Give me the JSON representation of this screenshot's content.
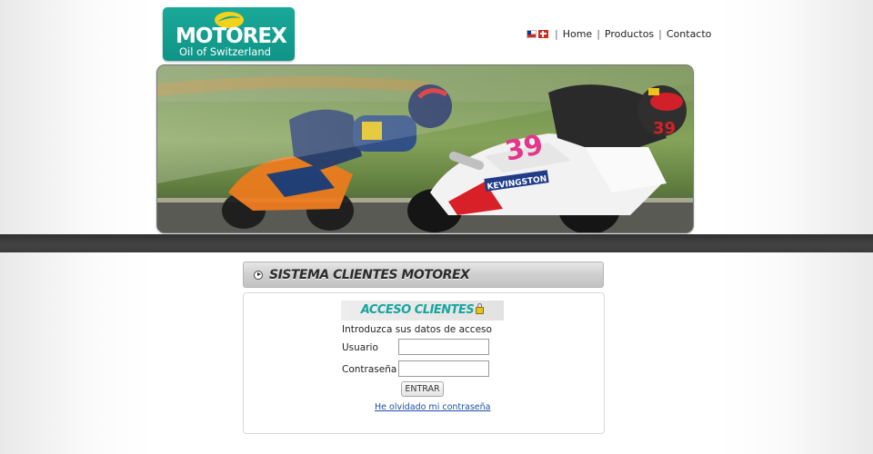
{
  "brand": {
    "name": "MOTOREX",
    "registered": "®",
    "tagline": "Oil of Switzerland",
    "color": "#14a394"
  },
  "nav": {
    "flags": [
      "chile-flag-icon",
      "switzerland-flag-icon"
    ],
    "separator": "|",
    "items": [
      "Home",
      "Productos",
      "Contacto"
    ]
  },
  "banner": {
    "bike_numbers": [
      "39"
    ],
    "sponsor_text": "KEVINGSTON"
  },
  "section": {
    "title": "SISTEMA CLIENTES MOTOREX",
    "icon": "play-circle-icon"
  },
  "login": {
    "title": "ACCESO CLIENTES",
    "title_icon": "lock-icon",
    "intro": "Introduzca sus datos de acceso",
    "user_label": "Usuario",
    "user_value": "",
    "pass_label": "Contraseña",
    "pass_value": "",
    "submit_label": "ENTRAR",
    "forgot_label": "He olvidado mi contraseña",
    "accent_color": "#17a5a0"
  }
}
